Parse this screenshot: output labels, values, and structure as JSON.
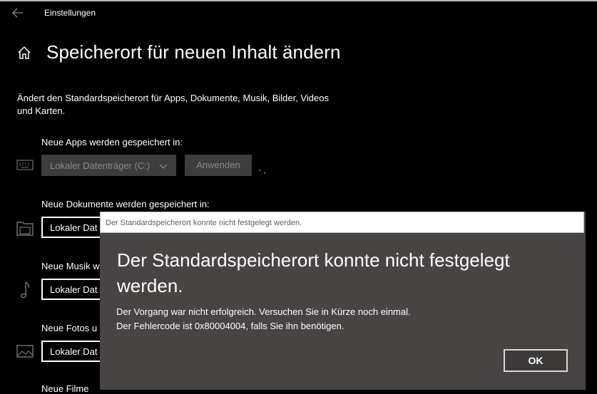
{
  "window": {
    "title": "Einstellungen"
  },
  "page": {
    "title": "Speicherort für neuen Inhalt ändern",
    "description": "Ändert den Standardspeicherort für Apps, Dokumente, Musik, Bilder, Videos und Karten."
  },
  "sections": {
    "apps": {
      "label": "Neue Apps werden gespeichert in:",
      "value": "Lokaler Datenträger (C:)",
      "apply_label": "Anwenden"
    },
    "documents": {
      "label": "Neue Dokumente werden gespeichert in:",
      "value": "Lokaler Dat"
    },
    "music": {
      "label": "Neue Musik w",
      "value": "Lokaler Dat"
    },
    "photos": {
      "label": "Neue Fotos u",
      "value": "Lokaler Dat"
    },
    "films": {
      "label": "Neue Filme"
    }
  },
  "dialog": {
    "titlebar": "Der Standardspeicherort konnte nicht festgelegt werden.",
    "heading": "Der Standardspeicherort konnte nicht festgelegt werden.",
    "message_line1": "Der Vorgang war nicht erfolgreich. Versuchen Sie in Kürze noch einmal.",
    "message_line2": "Der Fehlercode ist 0x80004004, falls Sie ihn benötigen.",
    "ok_label": "OK"
  },
  "icons": {
    "back": "back-arrow-icon",
    "home": "home-icon",
    "apps": "keyboard-icon",
    "documents": "folder-icon",
    "music": "music-note-icon",
    "photos": "image-icon"
  }
}
